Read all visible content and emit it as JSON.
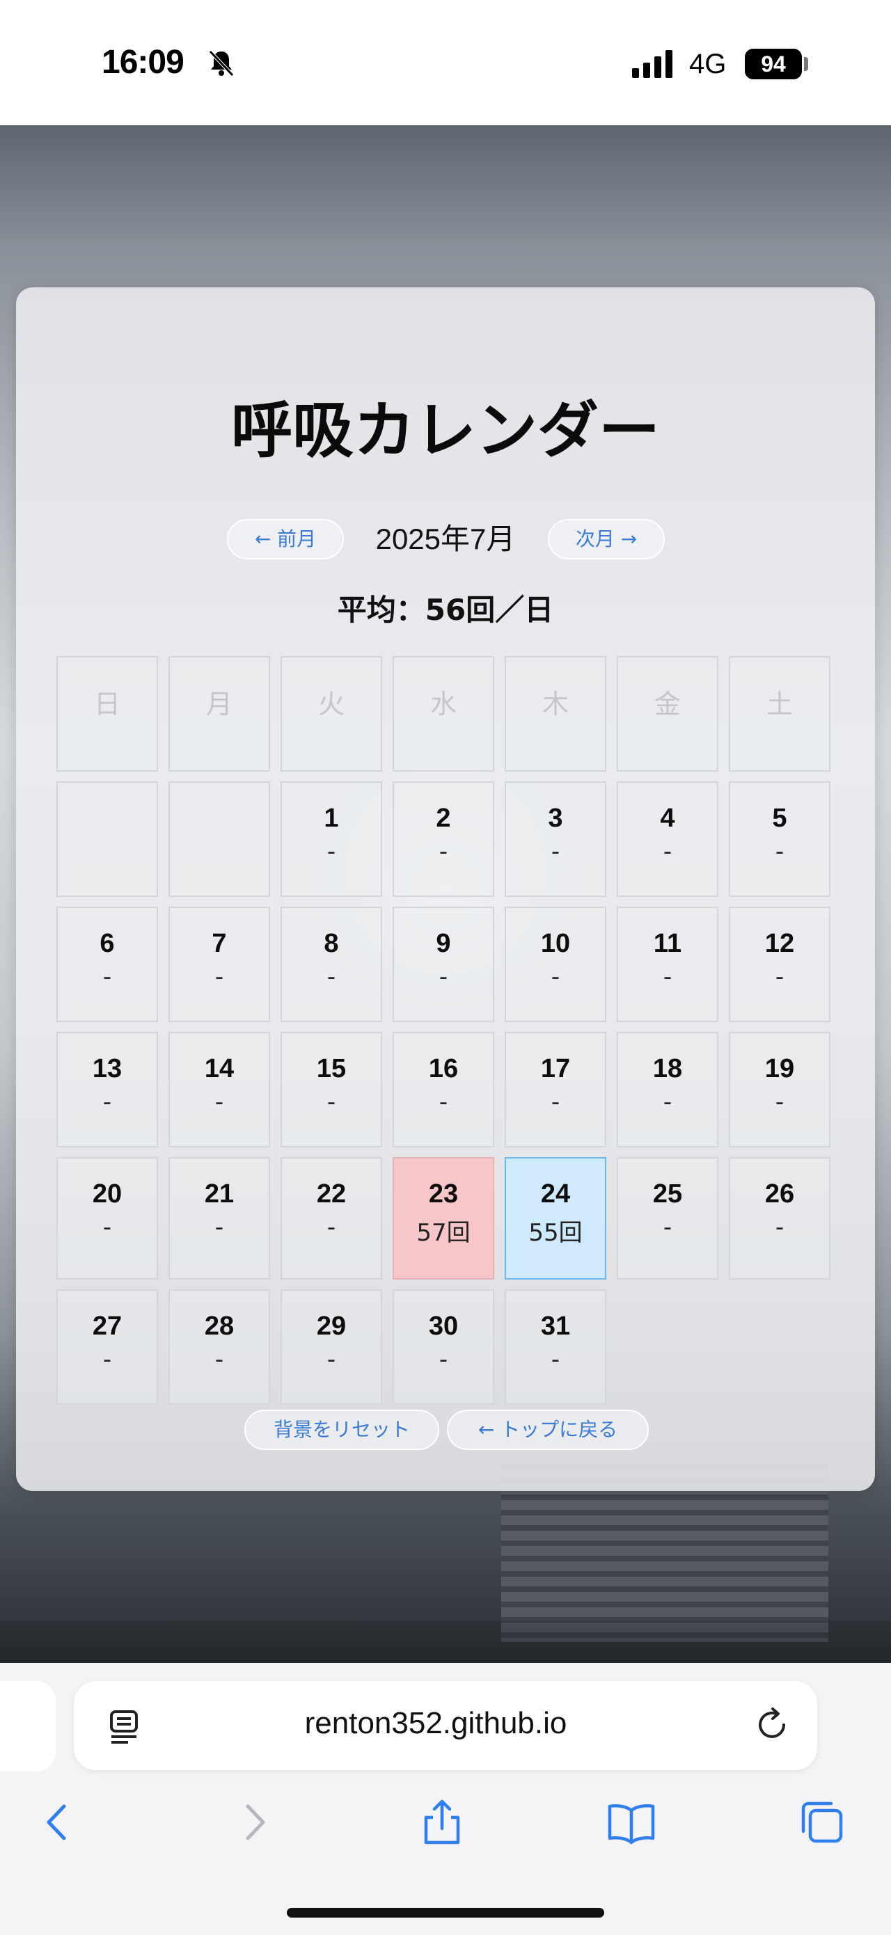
{
  "status_bar": {
    "time": "16:09",
    "network": "4G",
    "battery": "94"
  },
  "page": {
    "title": "呼吸カレンダー",
    "prev_label": "← 前月",
    "next_label": "次月 →",
    "month": "2025年7月",
    "average": "平均：56回／日",
    "reset_label": "背景をリセット",
    "top_label": "← トップに戻る"
  },
  "calendar": {
    "weekdays": [
      "日",
      "月",
      "火",
      "水",
      "木",
      "金",
      "土"
    ],
    "cells": [
      {
        "day": "",
        "count": ""
      },
      {
        "day": "",
        "count": ""
      },
      {
        "day": "1",
        "count": "-"
      },
      {
        "day": "2",
        "count": "-"
      },
      {
        "day": "3",
        "count": "-"
      },
      {
        "day": "4",
        "count": "-"
      },
      {
        "day": "5",
        "count": "-"
      },
      {
        "day": "6",
        "count": "-"
      },
      {
        "day": "7",
        "count": "-"
      },
      {
        "day": "8",
        "count": "-"
      },
      {
        "day": "9",
        "count": "-"
      },
      {
        "day": "10",
        "count": "-"
      },
      {
        "day": "11",
        "count": "-"
      },
      {
        "day": "12",
        "count": "-"
      },
      {
        "day": "13",
        "count": "-"
      },
      {
        "day": "14",
        "count": "-"
      },
      {
        "day": "15",
        "count": "-"
      },
      {
        "day": "16",
        "count": "-"
      },
      {
        "day": "17",
        "count": "-"
      },
      {
        "day": "18",
        "count": "-"
      },
      {
        "day": "19",
        "count": "-"
      },
      {
        "day": "20",
        "count": "-"
      },
      {
        "day": "21",
        "count": "-"
      },
      {
        "day": "22",
        "count": "-"
      },
      {
        "day": "23",
        "count": "57回",
        "highlight": "pink"
      },
      {
        "day": "24",
        "count": "55回",
        "highlight": "blue"
      },
      {
        "day": "25",
        "count": "-"
      },
      {
        "day": "26",
        "count": "-"
      },
      {
        "day": "27",
        "count": "-"
      },
      {
        "day": "28",
        "count": "-"
      },
      {
        "day": "29",
        "count": "-"
      },
      {
        "day": "30",
        "count": "-"
      },
      {
        "day": "31",
        "count": "-"
      }
    ]
  },
  "browser": {
    "url": "renton352.github.io"
  },
  "colors": {
    "accent": "#3a7bd5",
    "pink": "#f7c6c8",
    "blue": "#cfeafc"
  }
}
